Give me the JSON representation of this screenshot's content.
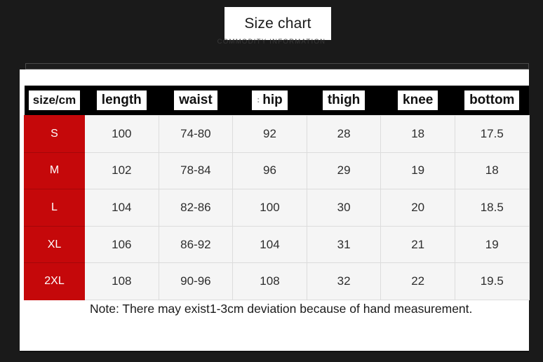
{
  "header": {
    "title": "Size chart",
    "subtitle": "COMMODITY INFORMATION"
  },
  "table": {
    "columns": [
      "size/cm",
      "length",
      "waist",
      "hip",
      "thigh",
      "knee",
      "bottom"
    ],
    "hip_prefix": ":",
    "rows": [
      {
        "size": "S",
        "length": "100",
        "waist": "74-80",
        "hip": "92",
        "thigh": "28",
        "knee": "18",
        "bottom": "17.5"
      },
      {
        "size": "M",
        "length": "102",
        "waist": "78-84",
        "hip": "96",
        "thigh": "29",
        "knee": "19",
        "bottom": "18"
      },
      {
        "size": "L",
        "length": "104",
        "waist": "82-86",
        "hip": "100",
        "thigh": "30",
        "knee": "20",
        "bottom": "18.5"
      },
      {
        "size": "XL",
        "length": "106",
        "waist": "86-92",
        "hip": "104",
        "thigh": "31",
        "knee": "21",
        "bottom": "19"
      },
      {
        "size": "2XL",
        "length": "108",
        "waist": "90-96",
        "hip": "108",
        "thigh": "32",
        "knee": "22",
        "bottom": "19.5"
      }
    ]
  },
  "note": "Note: There may exist1-3cm deviation because of hand measurement.",
  "colors": {
    "background": "#1a1a1a",
    "card": "#ffffff",
    "size_column": "#c5080a",
    "header_strip": "#000000",
    "cell": "#f5f5f5"
  }
}
